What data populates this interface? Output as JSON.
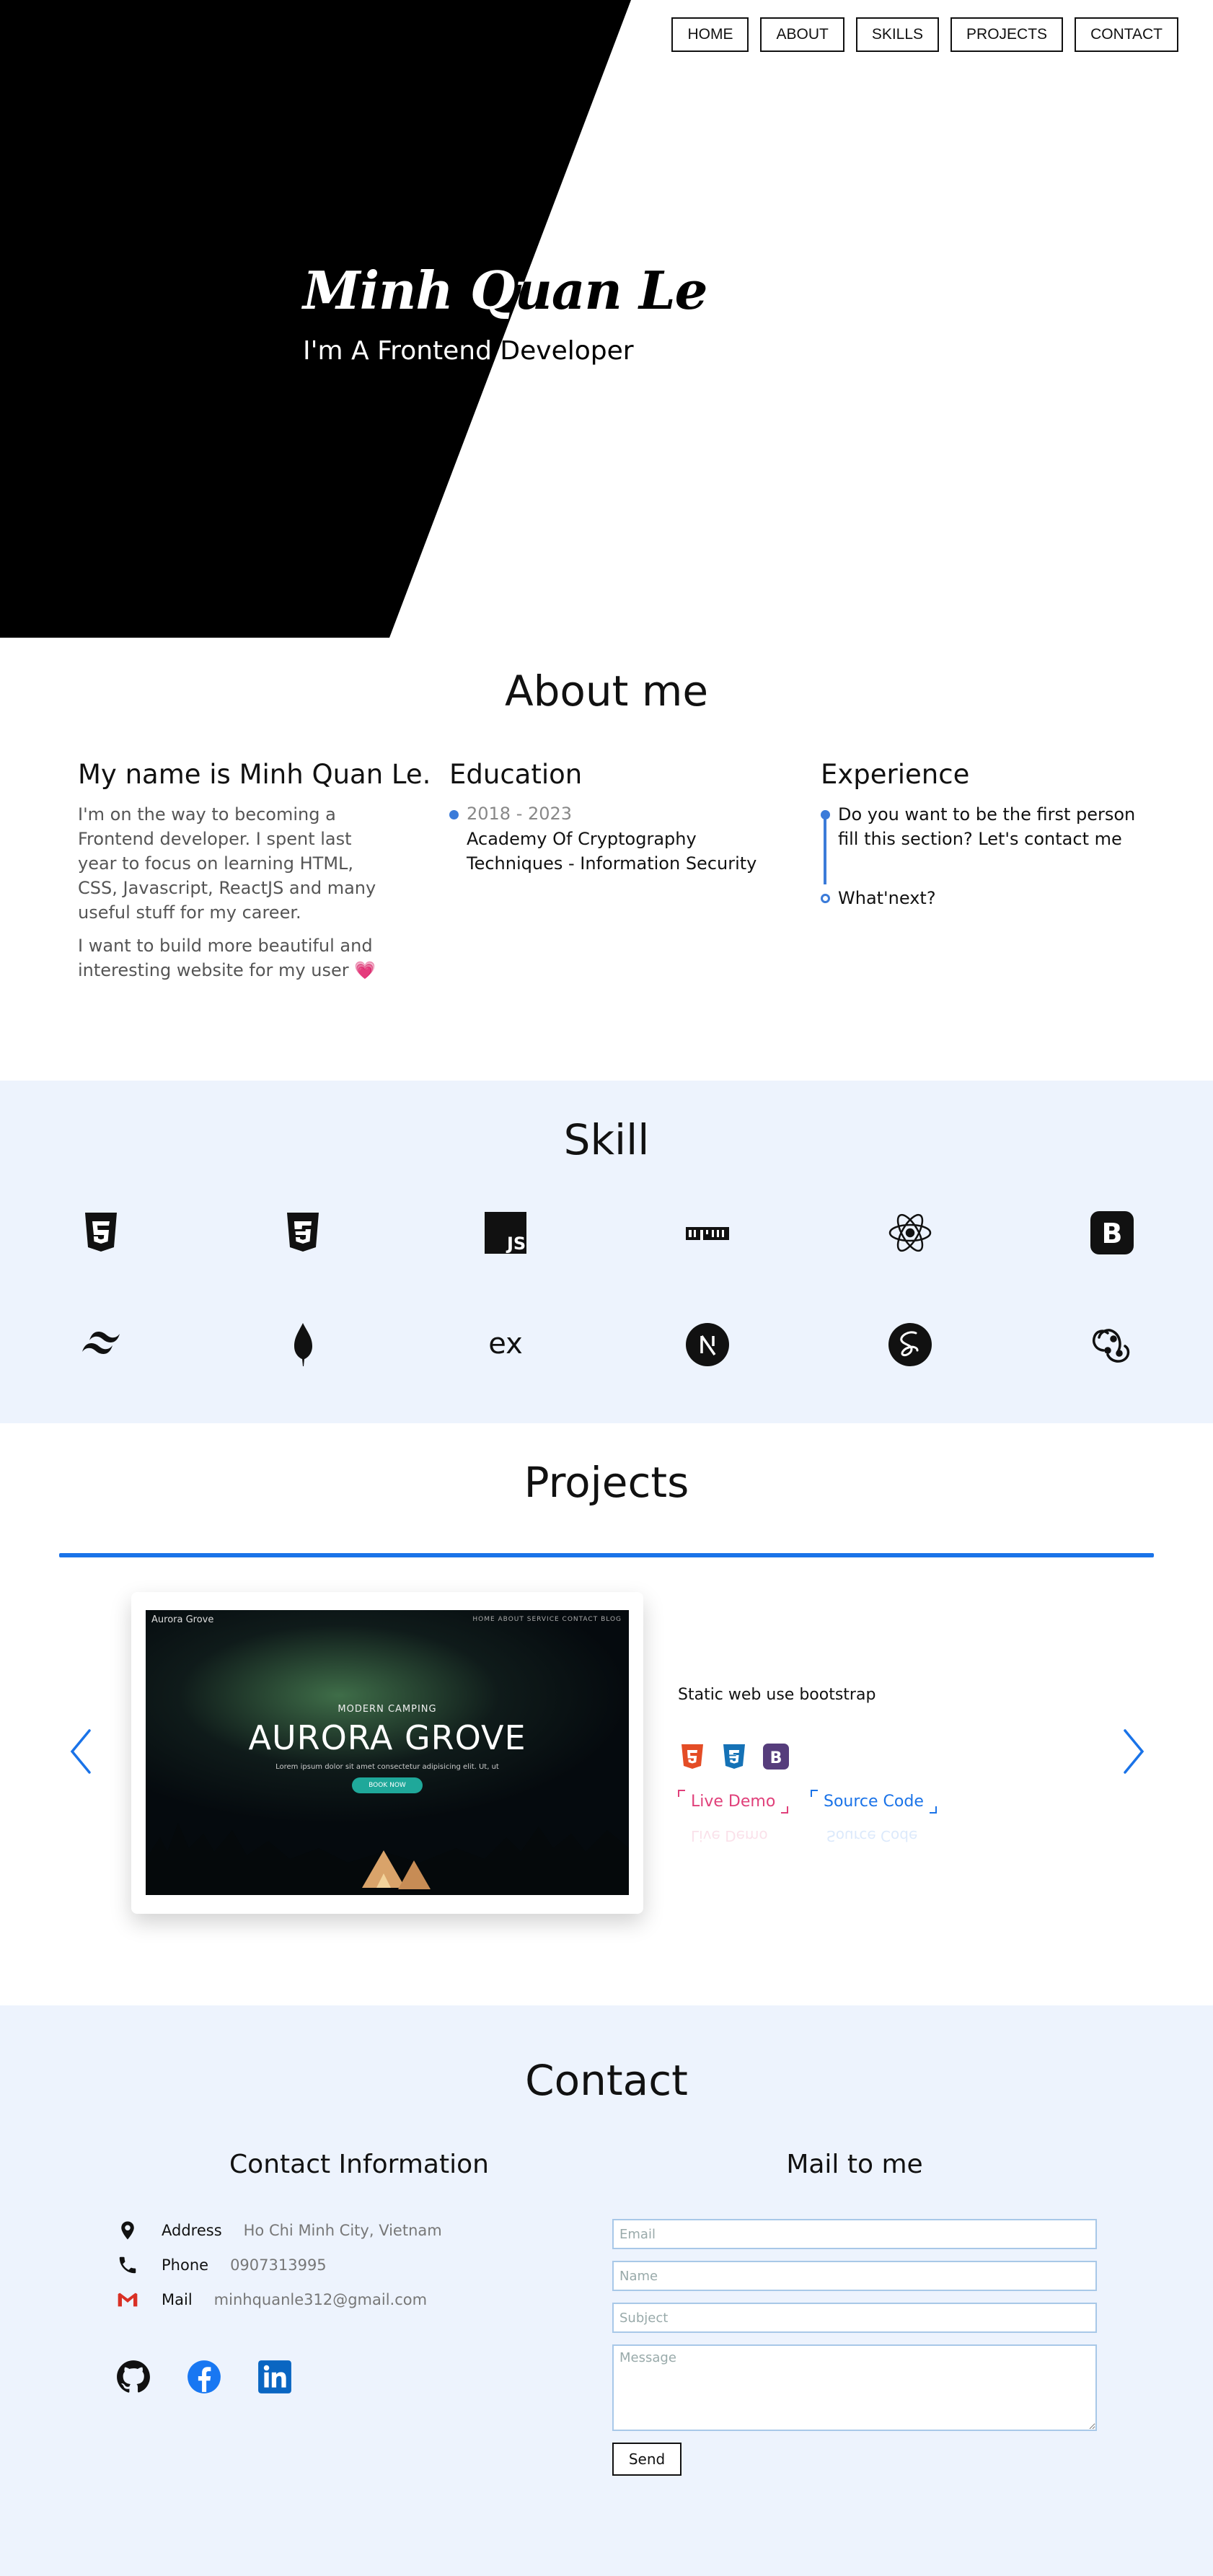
{
  "nav": [
    "HOME",
    "ABOUT",
    "SKILLS",
    "PROJECTS",
    "CONTACT"
  ],
  "hero": {
    "name": "Minh Quan Le",
    "role": "I'm A Frontend Developer"
  },
  "about": {
    "title": "About me",
    "intro_title": "My name is Minh Quan Le.",
    "intro_p1": "I'm on the way to becoming a Frontend developer. I spent last year to focus on learning HTML, CSS, Javascript, ReactJS and many useful stuff for my career.",
    "intro_p2": "I want to build more beautiful and interesting website for my user 💗",
    "education_title": "Education",
    "education_years": "2018 - 2023",
    "education_school": "Academy Of Cryptography Techniques - Information Security",
    "experience_title": "Experience",
    "experience_item1": "Do you want to be the first person fill this section? Let's contact me",
    "experience_item2": "What'next?"
  },
  "skills": {
    "title": "Skill",
    "icons": [
      "html5-icon",
      "css3-icon",
      "javascript-icon",
      "npm-icon",
      "react-icon",
      "bootstrap-icon",
      "tailwind-icon",
      "mongodb-icon",
      "express-icon",
      "nextjs-icon",
      "sass-icon",
      "redux-icon"
    ]
  },
  "projects": {
    "title": "Projects",
    "preview": {
      "brand": "Aurora Grove",
      "menu": "HOME   ABOUT   SERVICE   CONTACT   BLOG",
      "kicker": "MODERN CAMPING",
      "headline": "AURORA GROVE",
      "sub": "Lorem ipsum dolor sit amet consectetur adipisicing elit. Ut, ut",
      "button": "BOOK NOW"
    },
    "description": "Static web use bootstrap",
    "tech": [
      "html5-icon",
      "css3-icon",
      "bootstrap-icon"
    ],
    "live_demo": "Live Demo",
    "source_code": "Source Code"
  },
  "contact": {
    "title": "Contact",
    "info_title": "Contact Information",
    "mail_title": "Mail to me",
    "address_label": "Address",
    "address_value": "Ho Chi Minh City, Vietnam",
    "phone_label": "Phone",
    "phone_value": "0907313995",
    "mail_label": "Mail",
    "mail_value": "minhquanle312@gmail.com",
    "email_placeholder": "Email",
    "name_placeholder": "Name",
    "subject_placeholder": "Subject",
    "message_placeholder": "Message",
    "send": "Send",
    "socials": [
      "github-icon",
      "facebook-icon",
      "linkedin-icon"
    ]
  },
  "colors": {
    "accent": "#1a73e8",
    "timeline": "#3b7bd9",
    "section_bg": "#edf3fd",
    "live_demo": "#e0407a",
    "source_code": "#1a73e8"
  }
}
